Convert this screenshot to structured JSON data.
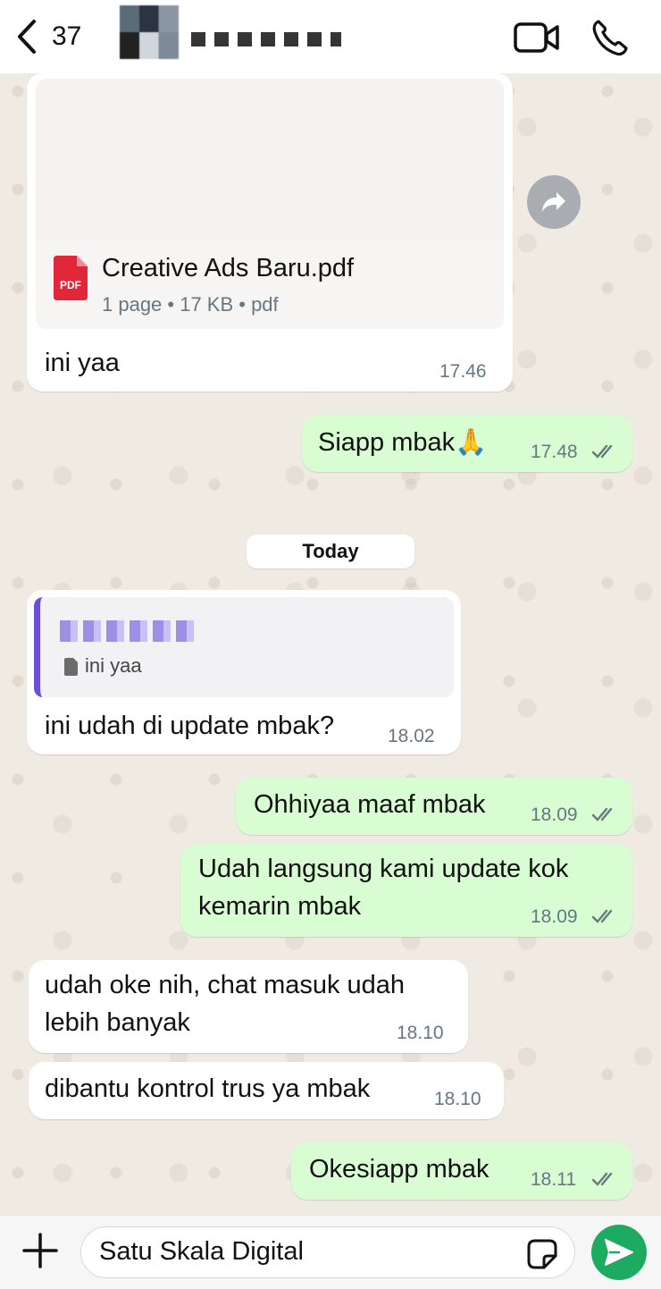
{
  "header": {
    "back_count": "37"
  },
  "messages": {
    "doc": {
      "file_name": "Creative Ads Baru.pdf",
      "file_meta": "1 page • 17 KB • pdf",
      "pdf_badge": "PDF",
      "caption": "ini yaa",
      "time": "17.46"
    },
    "m1": {
      "text": "Siapp mbak🙏",
      "time": "17.48"
    },
    "day": "Today",
    "reply": {
      "quoted_text": "ini yaa",
      "text": "ini udah di update mbak?",
      "time": "18.02"
    },
    "m2": {
      "text": "Ohhiyaa maaf mbak",
      "time": "18.09"
    },
    "m3": {
      "line1": "Udah langsung kami update kok",
      "line2": "kemarin mbak",
      "time": "18.09"
    },
    "m4": {
      "line1": "udah oke nih, chat masuk udah",
      "line2": "lebih banyak",
      "time": "18.10"
    },
    "m5": {
      "text": "dibantu kontrol trus ya mbak",
      "time": "18.10"
    },
    "m6": {
      "text": "Okesiapp mbak",
      "time": "18.11"
    }
  },
  "input": {
    "value": "Satu Skala Digital"
  },
  "colors": {
    "incoming": "#ffffff",
    "outgoing": "#d9fdd3",
    "send": "#1daa61",
    "quote_bar": "#6a4fd8",
    "pdf_red": "#e0283a"
  }
}
